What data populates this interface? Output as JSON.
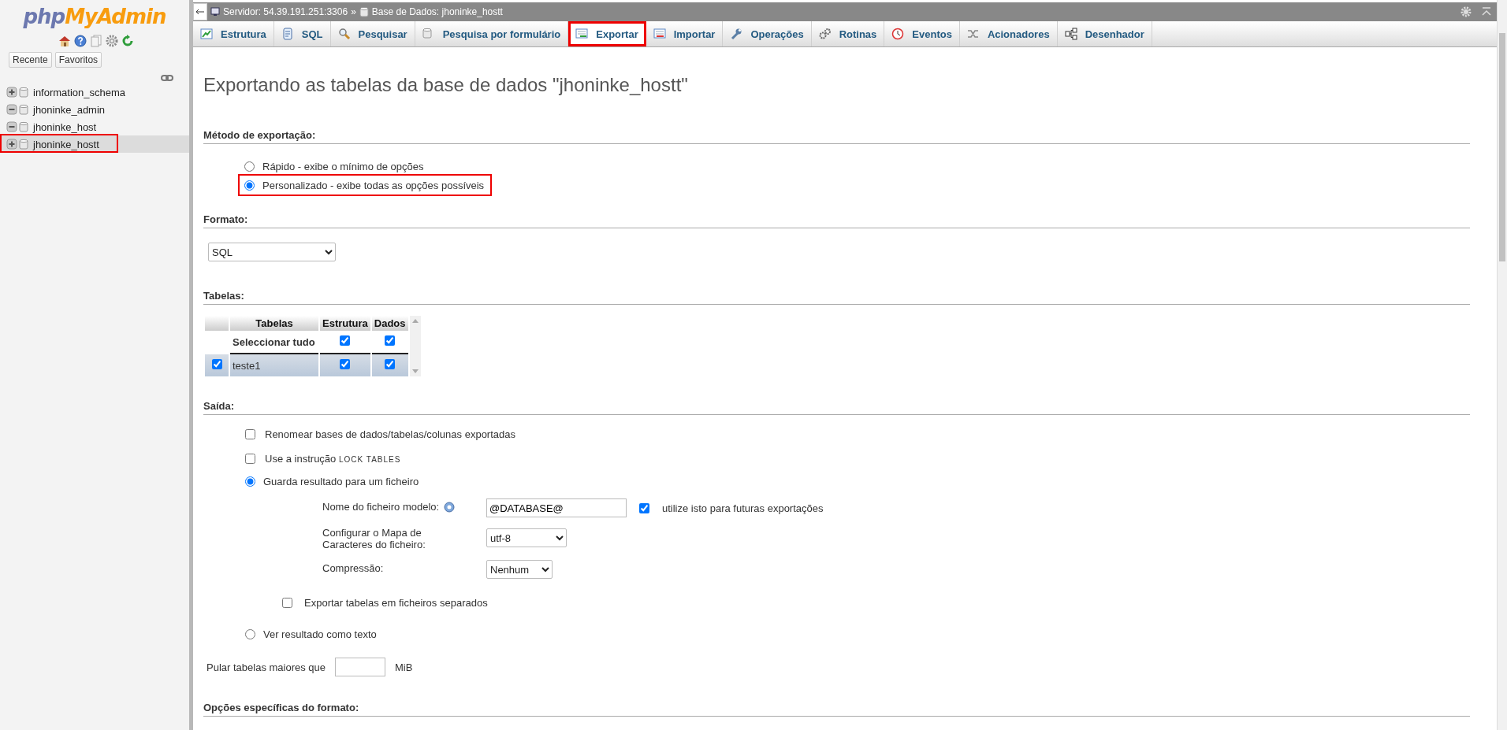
{
  "navigation": {
    "logo": {
      "part_1": "php",
      "part_2": "MyAdmin"
    },
    "buttons": [
      {
        "label": "Recente"
      },
      {
        "label": "Favoritos"
      }
    ],
    "databases": [
      {
        "name": "information_schema",
        "expanded": false,
        "selected": false,
        "highlighted": false
      },
      {
        "name": "jhoninke_admin",
        "expanded": true,
        "selected": false,
        "highlighted": false
      },
      {
        "name": "jhoninke_host",
        "expanded": true,
        "selected": false,
        "highlighted": false
      },
      {
        "name": "jhoninke_hostt",
        "expanded": false,
        "selected": true,
        "highlighted": true
      }
    ]
  },
  "breadcrumb": {
    "server": "Servidor: 54.39.191.251:3306",
    "separator": "»",
    "database": "Base de Dados: jhoninke_hostt"
  },
  "tabs": [
    {
      "label": "Estrutura",
      "selected": false,
      "highlighted": false
    },
    {
      "label": "SQL",
      "selected": false,
      "highlighted": false
    },
    {
      "label": "Pesquisar",
      "selected": false,
      "highlighted": false
    },
    {
      "label": "Pesquisa por formulário",
      "selected": false,
      "highlighted": false
    },
    {
      "label": "Exportar",
      "selected": true,
      "highlighted": true
    },
    {
      "label": "Importar",
      "selected": false,
      "highlighted": false
    },
    {
      "label": "Operações",
      "selected": false,
      "highlighted": false
    },
    {
      "label": "Rotinas",
      "selected": false,
      "highlighted": false
    },
    {
      "label": "Eventos",
      "selected": false,
      "highlighted": false
    },
    {
      "label": "Acionadores",
      "selected": false,
      "highlighted": false
    },
    {
      "label": "Desenhador",
      "selected": false,
      "highlighted": false
    }
  ],
  "page_title": "Exportando as tabelas da base de dados \"jhoninke_hostt\"",
  "export_method": {
    "heading": "Método de exportação:",
    "options": [
      {
        "label": "Rápido - exibe o mínimo de opções",
        "selected": false,
        "highlighted": false
      },
      {
        "label": "Personalizado - exibe todas as opções possíveis",
        "selected": true,
        "highlighted": true
      }
    ]
  },
  "format": {
    "heading": "Formato:",
    "value": "SQL"
  },
  "tables": {
    "heading": "Tabelas:",
    "columns": [
      "Tabelas",
      "Estrutura",
      "Dados"
    ],
    "select_all": {
      "label": "Seleccionar tudo",
      "structure_checked": true,
      "data_checked": true
    },
    "rows": [
      {
        "name": "teste1",
        "checked": true,
        "structure_checked": true,
        "data_checked": true
      }
    ]
  },
  "output": {
    "heading": "Saída:",
    "rename": {
      "label": "Renomear bases de dados/tabelas/colunas exportadas",
      "checked": false
    },
    "lock_tables": {
      "label": "Use a instrução",
      "code": "LOCK TABLES",
      "checked": false
    },
    "save_to_file": {
      "label": "Guarda resultado para um ficheiro",
      "selected": true
    },
    "filename": {
      "label": "Nome do ficheiro modelo:",
      "value": "@DATABASE@",
      "remember_label": "utilize isto para futuras exportações",
      "remember_checked": true
    },
    "charset": {
      "label": "Configurar o Mapa de Caracteres do ficheiro:",
      "value": "utf-8"
    },
    "compression": {
      "label": "Compressão:",
      "value": "Nenhum"
    },
    "separate_files": {
      "label": "Exportar tabelas em ficheiros separados",
      "checked": false
    },
    "as_text": {
      "label": "Ver resultado como texto",
      "selected": false
    },
    "skip_tables": {
      "label": "Pular tabelas maiores que",
      "unit": "MiB"
    }
  },
  "format_options": {
    "heading": "Opções específicas do formato:"
  }
}
